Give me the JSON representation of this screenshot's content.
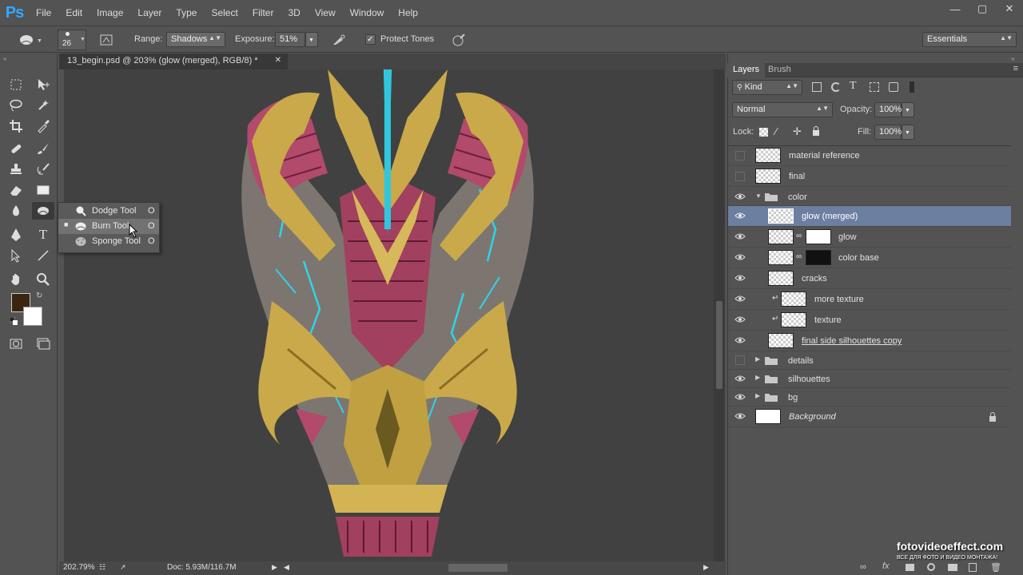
{
  "app": {
    "logo": "Ps"
  },
  "menu": [
    "File",
    "Edit",
    "Image",
    "Layer",
    "Type",
    "Select",
    "Filter",
    "3D",
    "View",
    "Window",
    "Help"
  ],
  "options": {
    "brush_size": "26",
    "range_label": "Range:",
    "range_value": "Shadows",
    "exposure_label": "Exposure:",
    "exposure_value": "51%",
    "protect_tones_label": "Protect Tones",
    "workspace": "Essentials"
  },
  "document": {
    "tab_title": "13_begin.psd @ 203% (glow (merged), RGB/8) *",
    "zoom": "202.79%",
    "doc_info": "Doc: 5.93M/116.7M"
  },
  "flyout": {
    "items": [
      {
        "label": "Dodge Tool",
        "key": "O",
        "selected": false
      },
      {
        "label": "Burn Tool",
        "key": "O",
        "selected": true
      },
      {
        "label": "Sponge Tool",
        "key": "O",
        "selected": false
      }
    ]
  },
  "colors": {
    "foreground": "#3a2510",
    "background": "#ffffff",
    "active_layer": "#6c7fa1",
    "accent": "#31a8ff"
  },
  "panel": {
    "tabs": [
      "Layers",
      "Brush"
    ],
    "filter_kind": "Kind",
    "blend_mode": "Normal",
    "opacity_label": "Opacity:",
    "opacity_value": "100%",
    "lock_label": "Lock:",
    "fill_label": "Fill:",
    "fill_value": "100%",
    "layers": [
      {
        "name": "material reference",
        "visible": false,
        "type": "layer"
      },
      {
        "name": "final",
        "visible": false,
        "type": "layer"
      },
      {
        "name": "color",
        "visible": true,
        "type": "group-open"
      },
      {
        "name": "glow (merged)",
        "visible": true,
        "type": "layer",
        "active": true
      },
      {
        "name": "glow",
        "visible": true,
        "type": "masked"
      },
      {
        "name": "color base",
        "visible": true,
        "type": "masked"
      },
      {
        "name": "cracks",
        "visible": true,
        "type": "layer"
      },
      {
        "name": "more texture",
        "visible": true,
        "type": "clipped"
      },
      {
        "name": "texture",
        "visible": true,
        "type": "clipped"
      },
      {
        "name": "final side silhouettes copy",
        "visible": true,
        "type": "layer"
      },
      {
        "name": "details",
        "visible": false,
        "type": "group"
      },
      {
        "name": "silhouettes",
        "visible": true,
        "type": "group"
      },
      {
        "name": "bg",
        "visible": true,
        "type": "group"
      },
      {
        "name": "Background",
        "visible": true,
        "type": "background"
      }
    ]
  },
  "watermark": {
    "main": "fotovideoeffect.com",
    "sub": "ВСЕ ДЛЯ ФОТО И ВИДЕО МОНТАЖА!"
  }
}
